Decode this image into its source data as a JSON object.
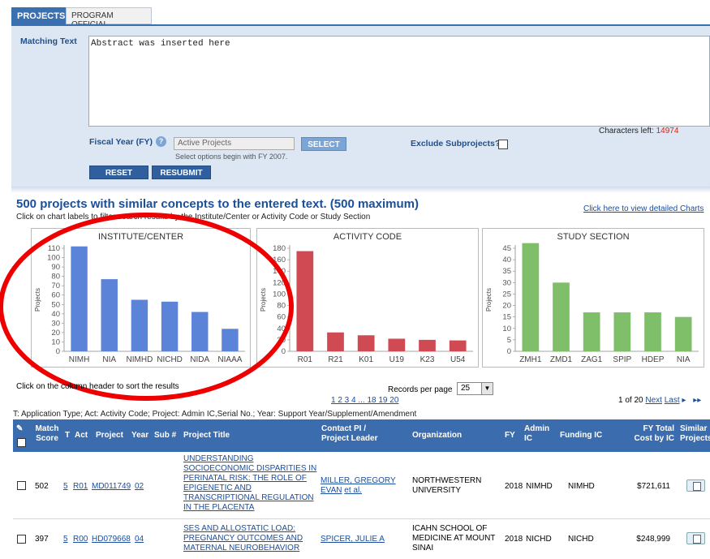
{
  "tabs": {
    "projects": "PROJECTS",
    "program_official": "PROGRAM OFFICIAL"
  },
  "form": {
    "matching_text_label": "Matching Text",
    "abstract_value": "Abstract was inserted here",
    "chars_left_label": "Characters left:",
    "chars_left_value": "14974",
    "fiscal_year_label": "Fiscal Year (FY)",
    "fiscal_year_value": "Active Projects",
    "select_label": "SELECT",
    "select_hint": "Select options begin with FY 2007.",
    "exclude_label": "Exclude Subprojects?",
    "reset_label": "RESET",
    "resubmit_label": "RESUBMIT"
  },
  "summary": {
    "heading": "500 projects with similar concepts to the entered text. (500 maximum)",
    "instruction": "Click on chart labels to filter search results by the Institute/Center or Activity Code or Study Section",
    "charts_link": "Click here to view detailed Charts"
  },
  "chart_data": [
    {
      "type": "bar",
      "title": "INSTITUTE/CENTER",
      "ylabel": "Projects",
      "categories": [
        "NIMH",
        "NIA",
        "NIMHD",
        "NICHD",
        "NIDA",
        "NIAAA"
      ],
      "values": [
        112,
        77,
        55,
        53,
        42,
        24
      ],
      "ylim": [
        0,
        110
      ],
      "yticks": [
        0,
        10,
        20,
        30,
        40,
        50,
        60,
        70,
        80,
        90,
        100,
        110
      ],
      "color": "#5b84d8"
    },
    {
      "type": "bar",
      "title": "ACTIVITY CODE",
      "ylabel": "Projects",
      "categories": [
        "R01",
        "R21",
        "K01",
        "U19",
        "K23",
        "U54"
      ],
      "values": [
        175,
        33,
        28,
        22,
        20,
        19
      ],
      "ylim": [
        0,
        180
      ],
      "yticks": [
        0,
        20,
        40,
        60,
        80,
        100,
        120,
        140,
        160,
        180
      ],
      "color": "#cf4a52"
    },
    {
      "type": "bar",
      "title": "STUDY SECTION",
      "ylabel": "Projects",
      "categories": [
        "ZMH1",
        "ZMD1",
        "ZAG1",
        "SPIP",
        "HDEP",
        "NIA"
      ],
      "values": [
        48,
        30,
        17,
        17,
        17,
        15
      ],
      "ylim": [
        0,
        45
      ],
      "yticks": [
        0,
        5,
        10,
        15,
        20,
        25,
        30,
        35,
        40,
        45
      ],
      "color": "#7fbf6a"
    }
  ],
  "results": {
    "sort_hint": "Click on the column header to sort the results",
    "records_per_page_label": "Records per page",
    "records_per_page_value": "25",
    "pagination": "1 2 3 4 ... 18 19 20",
    "page_status": "1 of 20",
    "next": "Next",
    "last": "Last",
    "legend": "T: Application Type; Act: Activity Code; Project: Admin IC,Serial No.; Year: Support Year/Supplement/Amendment",
    "columns": [
      "Match Score",
      "T",
      "Act",
      "Project",
      "Year",
      "Sub #",
      "Project Title",
      "Contact PI / Project Leader",
      "Organization",
      "FY",
      "Admin IC",
      "Funding IC",
      "FY Total Cost by IC",
      "Similar Projects"
    ],
    "rows": [
      {
        "score": "502",
        "t": "5",
        "act": "R01",
        "project": "MD011749",
        "year": "02",
        "title": "UNDERSTANDING SOCIOECONOMIC DISPARITIES IN PERINATAL RISK: THE ROLE OF EPIGENETIC AND TRANSCRIPTIONAL REGULATION IN THE PLACENTA",
        "pi": "MILLER, GREGORY EVAN",
        "etal": "et al.",
        "org": "NORTHWESTERN UNIVERSITY",
        "fy": "2018",
        "admin": "NIMHD",
        "funding": "NIMHD",
        "cost": "$721,611"
      },
      {
        "score": "397",
        "t": "5",
        "act": "R00",
        "project": "HD079668",
        "year": "04",
        "title": "SES AND ALLOSTATIC LOAD: PREGNANCY OUTCOMES AND MATERNAL NEUROBEHAVIOR",
        "pi": "SPICER, JULIE A",
        "etal": "",
        "org": "ICAHN SCHOOL OF MEDICINE AT MOUNT SINAI",
        "fy": "2018",
        "admin": "NICHD",
        "funding": "NICHD",
        "cost": "$248,999"
      }
    ]
  }
}
